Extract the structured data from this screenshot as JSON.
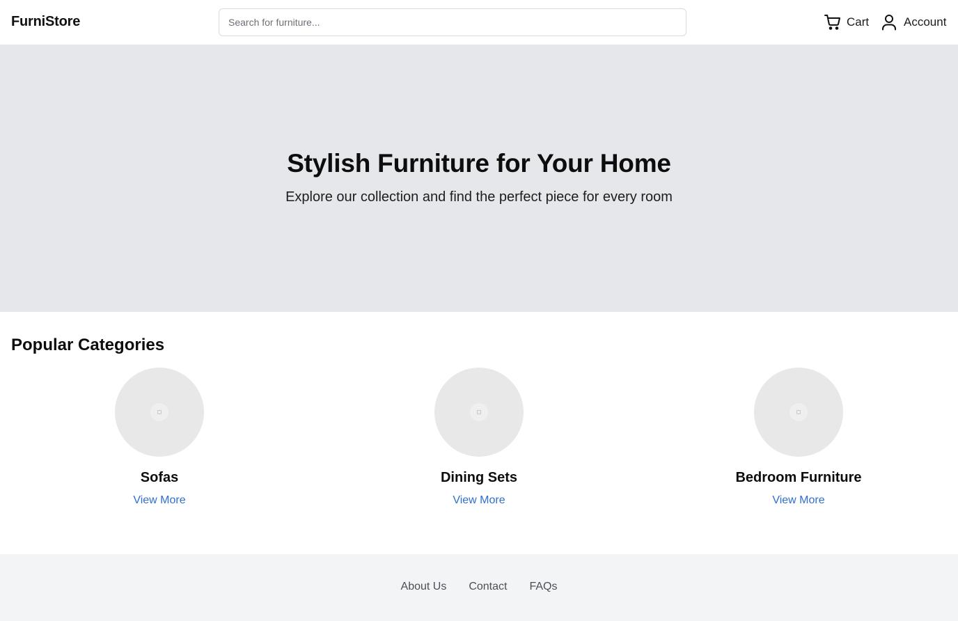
{
  "header": {
    "logo": "FurniStore",
    "search_placeholder": "Search for furniture...",
    "cart_label": "Cart",
    "account_label": "Account",
    "icons": {
      "cart": "shopping-cart-icon",
      "account": "user-icon"
    }
  },
  "hero": {
    "title": "Stylish Furniture for Your Home",
    "subtitle": "Explore our collection and find the perfect piece for every room"
  },
  "categories": {
    "title": "Popular Categories",
    "items": [
      {
        "name": "Sofas",
        "link": "View More"
      },
      {
        "name": "Dining Sets",
        "link": "View More"
      },
      {
        "name": "Bedroom Furniture",
        "link": "View More"
      }
    ]
  },
  "footer": {
    "links": [
      "About Us",
      "Contact",
      "FAQs"
    ]
  },
  "colors": {
    "hero_bg": "#e5e7eb",
    "footer_bg": "#f3f4f6",
    "link": "#2f6fd1",
    "placeholder_circle": "#e8e8e8"
  }
}
